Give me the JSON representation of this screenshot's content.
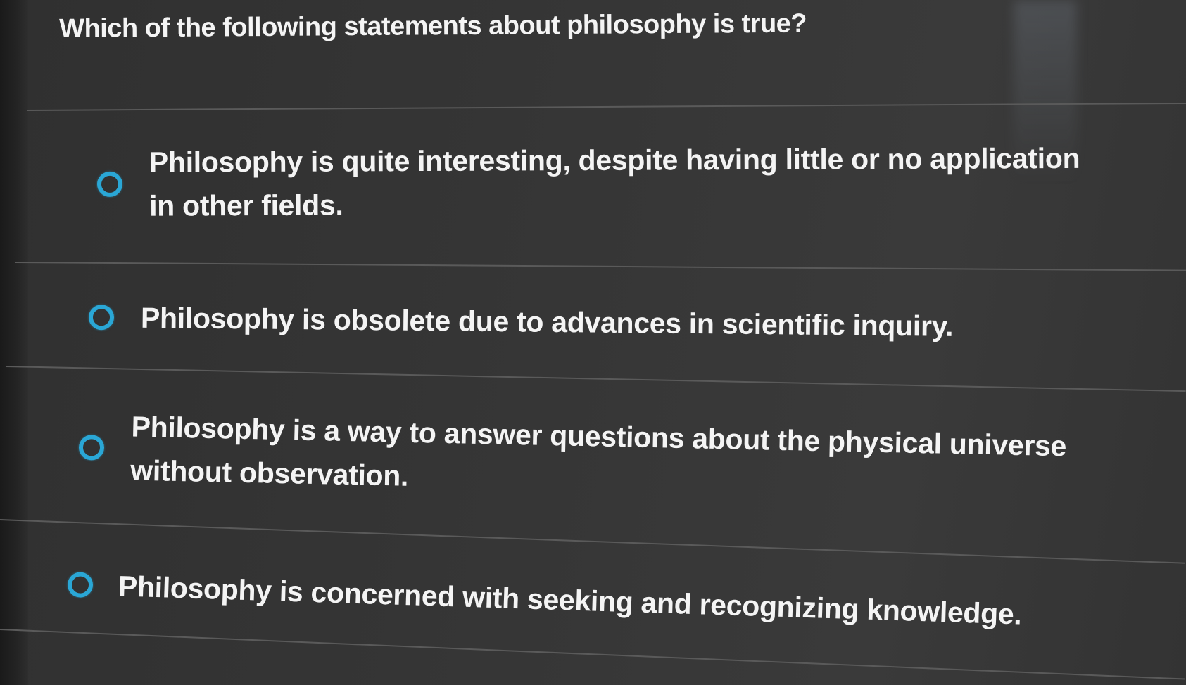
{
  "question": {
    "text": "Which of the following statements about philosophy is true?"
  },
  "options": [
    {
      "label": "Philosophy is quite interesting, despite having little or no application in other fields."
    },
    {
      "label": "Philosophy is obsolete due to advances in scientific inquiry."
    },
    {
      "label": "Philosophy is a way to answer questions about the physical universe without observation."
    },
    {
      "label": "Philosophy is concerned with seeking and recognizing knowledge."
    }
  ],
  "colors": {
    "background": "#353535",
    "text": "#f4f4f4",
    "radio_accent": "#2aa7d6",
    "divider": "#5a5a5a"
  },
  "icons": {
    "radio": "radio-unselected-icon"
  }
}
